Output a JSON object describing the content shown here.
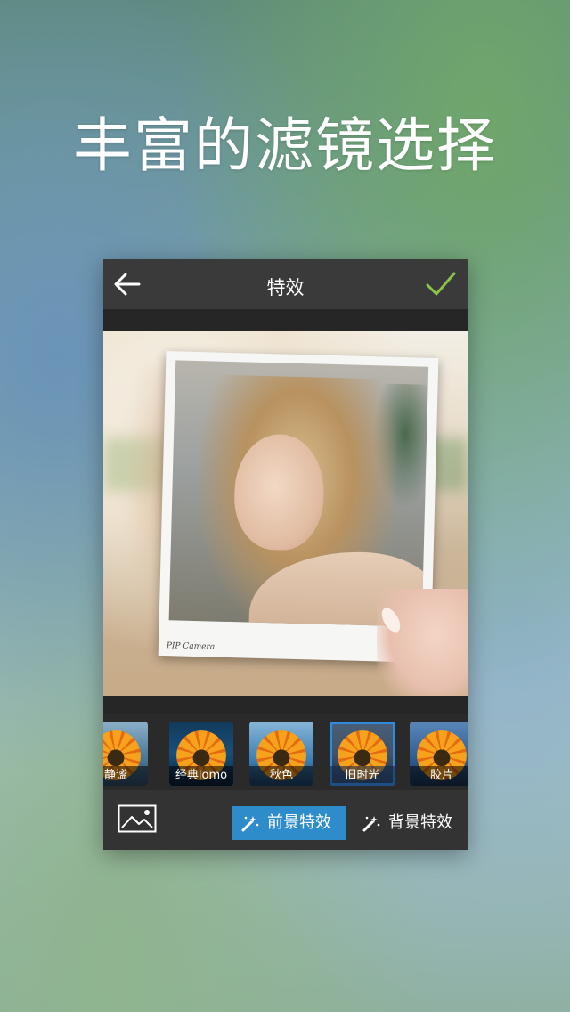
{
  "headline": "丰富的滤镜选择",
  "screen": {
    "title": "特效",
    "back_icon": "back-arrow-icon",
    "confirm_icon": "checkmark-icon",
    "photo_caption": "PIP Camera",
    "filters": [
      {
        "label": "静谧",
        "selected": false
      },
      {
        "label": "经典lomo",
        "selected": false
      },
      {
        "label": "秋色",
        "selected": false
      },
      {
        "label": "旧时光",
        "selected": true
      },
      {
        "label": "胶片",
        "selected": false
      }
    ],
    "tabs": {
      "foreground": "前景特效",
      "background": "背景特效"
    },
    "accent_color": "#2f8ccb",
    "confirm_color": "#8bc34a"
  }
}
